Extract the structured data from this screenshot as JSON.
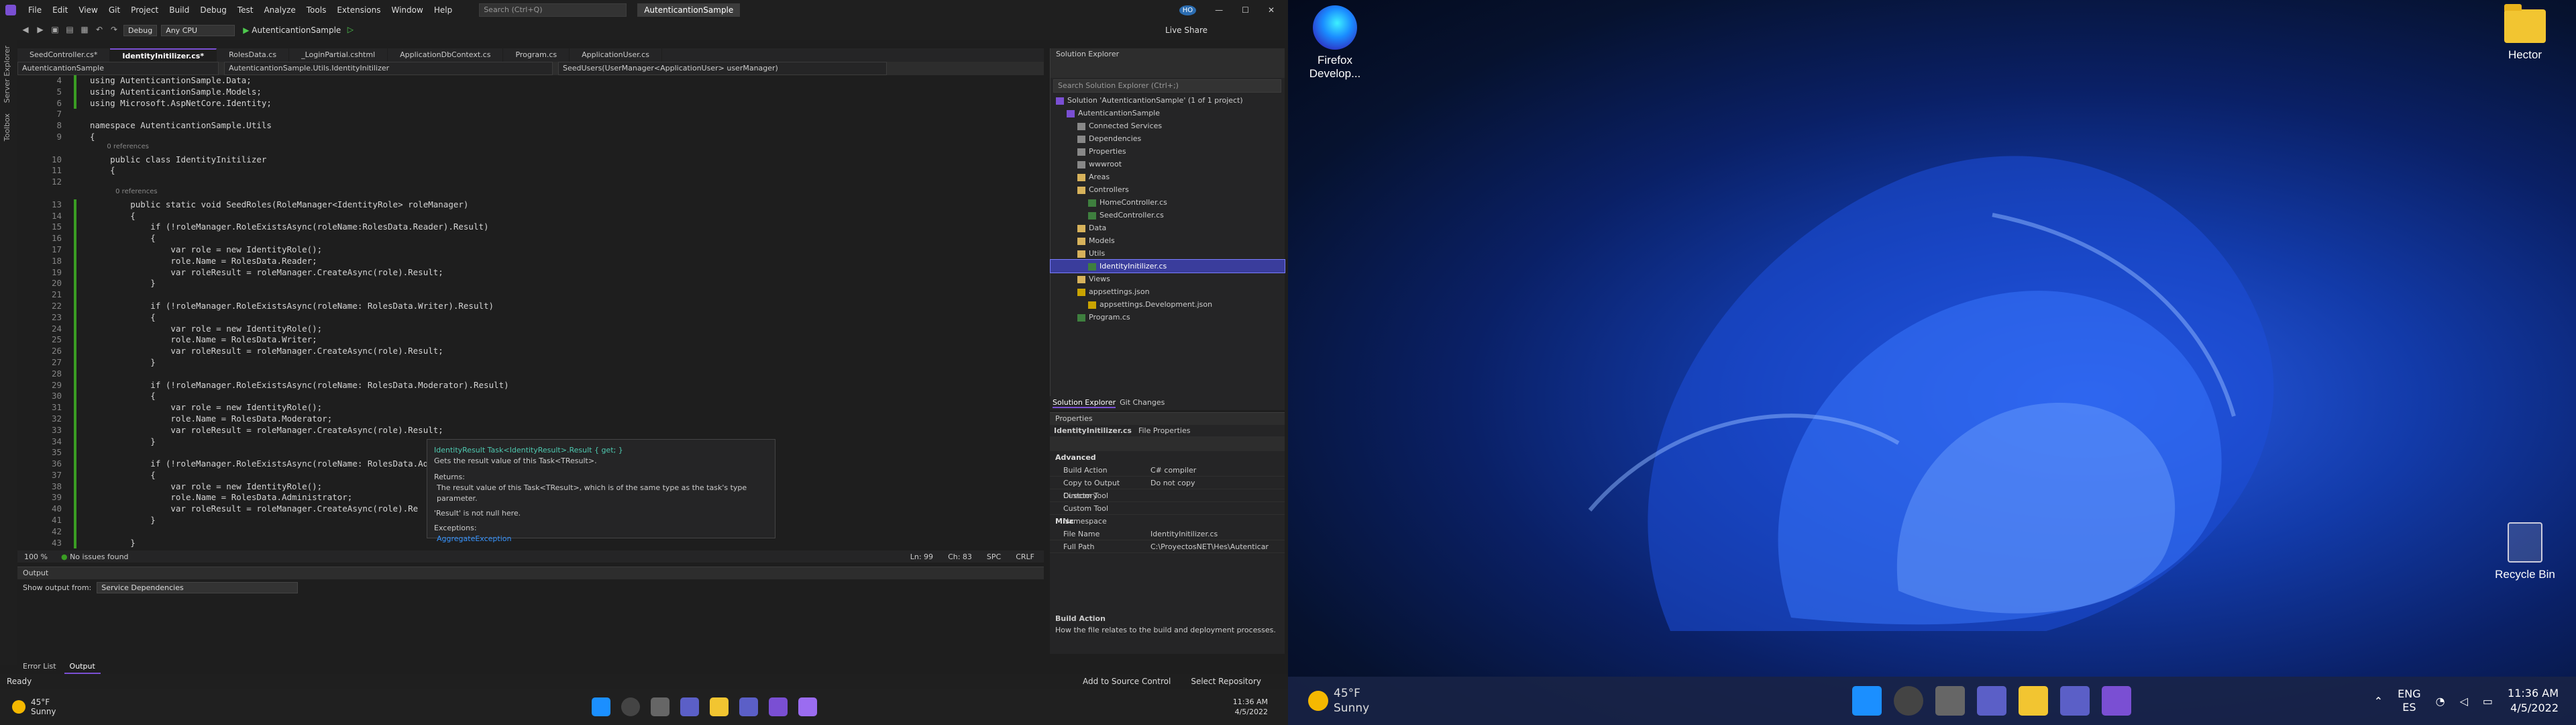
{
  "vs": {
    "menus": [
      "File",
      "Edit",
      "View",
      "Git",
      "Project",
      "Build",
      "Debug",
      "Test",
      "Analyze",
      "Tools",
      "Extensions",
      "Window",
      "Help"
    ],
    "search_placeholder": "Search (Ctrl+Q)",
    "solution_name": "AutenticantionSample",
    "user_initials": "HO",
    "config": "Debug",
    "platform": "Any CPU",
    "start_target": "AutenticantionSample",
    "live_share": "Live Share",
    "side_tabs": [
      "Server Explorer",
      "Toolbox"
    ],
    "tabs": [
      "SeedController.cs*",
      "IdentityInitilizer.cs*",
      "RolesData.cs",
      "_LoginPartial.cshtml",
      "ApplicationDbContext.cs",
      "Program.cs",
      "ApplicationUser.cs"
    ],
    "nav": [
      "AutenticantionSample",
      "AutenticantionSample.Utils.IdentityInitilizer",
      "SeedUsers(UserManager<ApplicationUser> userManager)"
    ],
    "code": [
      {
        "n": "4",
        "t": "using AutenticantionSample.Data;"
      },
      {
        "n": "5",
        "t": "using AutenticantionSample.Models;"
      },
      {
        "n": "6",
        "t": "using Microsoft.AspNetCore.Identity;"
      },
      {
        "n": "7",
        "t": ""
      },
      {
        "n": "8",
        "t": "namespace AutenticantionSample.Utils"
      },
      {
        "n": "9",
        "t": "{"
      },
      {
        "n": "",
        "t": "        0 references"
      },
      {
        "n": "10",
        "t": "    public class IdentityInitilizer"
      },
      {
        "n": "11",
        "t": "    {"
      },
      {
        "n": "12",
        "t": ""
      },
      {
        "n": "",
        "t": "            0 references"
      },
      {
        "n": "13",
        "t": "        public static void SeedRoles(RoleManager<IdentityRole> roleManager)"
      },
      {
        "n": "14",
        "t": "        {"
      },
      {
        "n": "15",
        "t": "            if (!roleManager.RoleExistsAsync(roleName:RolesData.Reader).Result)"
      },
      {
        "n": "16",
        "t": "            {"
      },
      {
        "n": "17",
        "t": "                var role = new IdentityRole();"
      },
      {
        "n": "18",
        "t": "                role.Name = RolesData.Reader;"
      },
      {
        "n": "19",
        "t": "                var roleResult = roleManager.CreateAsync(role).Result;"
      },
      {
        "n": "20",
        "t": "            }"
      },
      {
        "n": "21",
        "t": ""
      },
      {
        "n": "22",
        "t": "            if (!roleManager.RoleExistsAsync(roleName: RolesData.Writer).Result)"
      },
      {
        "n": "23",
        "t": "            {"
      },
      {
        "n": "24",
        "t": "                var role = new IdentityRole();"
      },
      {
        "n": "25",
        "t": "                role.Name = RolesData.Writer;"
      },
      {
        "n": "26",
        "t": "                var roleResult = roleManager.CreateAsync(role).Result;"
      },
      {
        "n": "27",
        "t": "            }"
      },
      {
        "n": "28",
        "t": ""
      },
      {
        "n": "29",
        "t": "            if (!roleManager.RoleExistsAsync(roleName: RolesData.Moderator).Result)"
      },
      {
        "n": "30",
        "t": "            {"
      },
      {
        "n": "31",
        "t": "                var role = new IdentityRole();"
      },
      {
        "n": "32",
        "t": "                role.Name = RolesData.Moderator;"
      },
      {
        "n": "33",
        "t": "                var roleResult = roleManager.CreateAsync(role).Result;"
      },
      {
        "n": "34",
        "t": "            }"
      },
      {
        "n": "35",
        "t": ""
      },
      {
        "n": "36",
        "t": "            if (!roleManager.RoleExistsAsync(roleName: RolesData.Adm"
      },
      {
        "n": "37",
        "t": "            {"
      },
      {
        "n": "38",
        "t": "                var role = new IdentityRole();"
      },
      {
        "n": "39",
        "t": "                role.Name = RolesData.Administrator;"
      },
      {
        "n": "40",
        "t": "                var roleResult = roleManager.CreateAsync(role).Re"
      },
      {
        "n": "41",
        "t": "            }"
      },
      {
        "n": "42",
        "t": ""
      },
      {
        "n": "43",
        "t": "        }"
      }
    ],
    "tooltip": {
      "sig": "IdentityResult Task<IdentityResult>.Result { get; }",
      "desc": "Gets the result value of this Task<TResult>.",
      "returns_h": "Returns:",
      "returns": "The result value of this Task<TResult>, which is of the same type as the task's type parameter.",
      "notnull": "'Result' is not null here.",
      "ex_h": "Exceptions:",
      "ex": "AggregateException"
    },
    "editor_status": {
      "zoom": "100 %",
      "issues": "No issues found",
      "ln": "Ln: 99",
      "ch": "Ch: 83",
      "spc": "SPC",
      "crlf": "CRLF"
    },
    "output": {
      "title": "Output",
      "show_label": "Show output from:",
      "source": "Service Dependencies"
    },
    "bottom_tabs": [
      "Error List",
      "Output"
    ],
    "status": {
      "ready": "Ready",
      "add_src": "Add to Source Control",
      "select_repo": "Select Repository"
    }
  },
  "solution_explorer": {
    "title": "Solution Explorer",
    "search_placeholder": "Search Solution Explorer (Ctrl+;)",
    "items": [
      {
        "label": "Solution 'AutenticantionSample' (1 of 1 project)",
        "indent": 0,
        "icon": "sol"
      },
      {
        "label": "AutenticantionSample",
        "indent": 1,
        "icon": "proj"
      },
      {
        "label": "Connected Services",
        "indent": 2,
        "icon": "gen"
      },
      {
        "label": "Dependencies",
        "indent": 2,
        "icon": "gen"
      },
      {
        "label": "Properties",
        "indent": 2,
        "icon": "gen"
      },
      {
        "label": "wwwroot",
        "indent": 2,
        "icon": "gen"
      },
      {
        "label": "Areas",
        "indent": 2,
        "icon": "folder"
      },
      {
        "label": "Controllers",
        "indent": 2,
        "icon": "folder"
      },
      {
        "label": "HomeController.cs",
        "indent": 3,
        "icon": "cs"
      },
      {
        "label": "SeedController.cs",
        "indent": 3,
        "icon": "cs"
      },
      {
        "label": "Data",
        "indent": 2,
        "icon": "folder"
      },
      {
        "label": "Models",
        "indent": 2,
        "icon": "folder"
      },
      {
        "label": "Utils",
        "indent": 2,
        "icon": "folder"
      },
      {
        "label": "IdentityInitilizer.cs",
        "indent": 3,
        "icon": "cs",
        "selected": true
      },
      {
        "label": "Views",
        "indent": 2,
        "icon": "folder"
      },
      {
        "label": "appsettings.json",
        "indent": 2,
        "icon": "json"
      },
      {
        "label": "appsettings.Development.json",
        "indent": 3,
        "icon": "json"
      },
      {
        "label": "Program.cs",
        "indent": 2,
        "icon": "cs"
      }
    ],
    "tabs": [
      "Solution Explorer",
      "Git Changes"
    ]
  },
  "properties": {
    "title": "Properties",
    "subject": "IdentityInitilizer.cs",
    "subject_type": "File Properties",
    "cat_advanced": "Advanced",
    "rows_adv": [
      [
        "Build Action",
        "C# compiler"
      ],
      [
        "Copy to Output Directory",
        "Do not copy"
      ],
      [
        "Custom Tool",
        ""
      ],
      [
        "Custom Tool Namespace",
        ""
      ]
    ],
    "cat_misc": "Misc",
    "rows_misc": [
      [
        "File Name",
        "IdentityInitilizer.cs"
      ],
      [
        "Full Path",
        "C:\\ProyectosNET\\Hes\\Autenticar"
      ]
    ],
    "desc_title": "Build Action",
    "desc": "How the file relates to the build and deployment processes."
  },
  "taskbar1": {
    "temp": "45°F",
    "cond": "Sunny",
    "time": "11:36 AM",
    "date": "4/5/2022"
  },
  "desktop": {
    "icons": [
      "Firefox Develop...",
      "Hector",
      "Recycle Bin"
    ]
  },
  "taskbar2": {
    "temp": "45°F",
    "cond": "Sunny",
    "lang1": "ENG",
    "lang2": "ES",
    "time": "11:36 AM",
    "date": "4/5/2022"
  }
}
